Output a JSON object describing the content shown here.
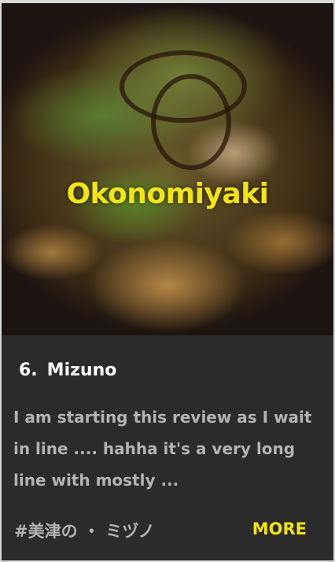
{
  "card": {
    "hero_title": "Okonomiyaki",
    "rank": "6.",
    "name": "Mizuno",
    "excerpt": "I am starting this review as I wait in line .... hahha it's a very long line with mostly ...",
    "tag": "#美津の ・ ミヅノ",
    "more_label": "MORE",
    "accent_color": "#f2e31b"
  }
}
